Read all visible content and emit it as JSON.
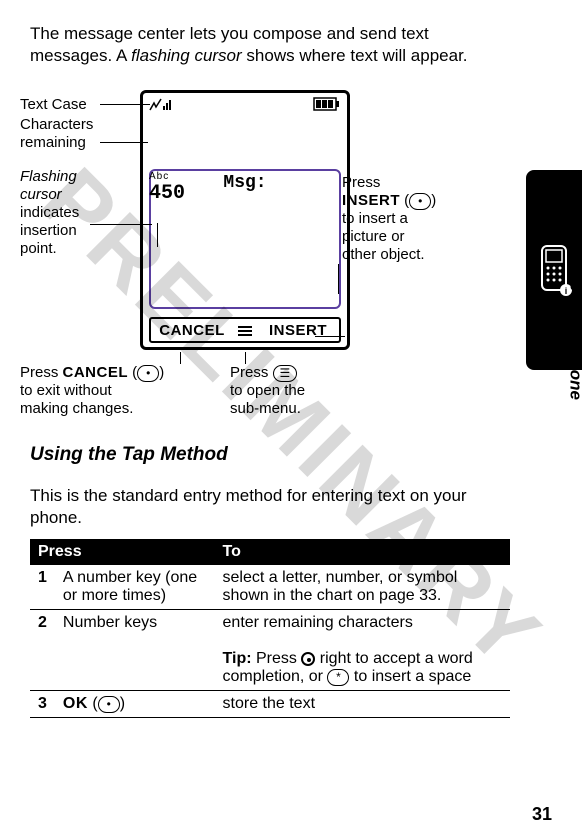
{
  "watermark": "PRELIMINARY",
  "intro_a": "The message center lets you compose and send text messages. A ",
  "intro_b_i": "flashing cursor",
  "intro_c": " shows where text will appear.",
  "screen": {
    "abc": "Abc",
    "count": "450",
    "msg": "Msg:",
    "cancel": "CANCEL",
    "insert": "INSERT"
  },
  "callouts": {
    "textcase": "Text Case",
    "chars1": "Characters",
    "chars2": "remaining",
    "flash1": "Flashing",
    "flash2": "cursor",
    "flash3": "indicates",
    "flash4": "insertion",
    "flash5": "point.",
    "right1": "Press",
    "right2": "INSERT",
    "right2b": " (",
    "right2c": ")",
    "right3": "to insert a",
    "right4": "picture or",
    "right5": "other object.",
    "bl1": "Press ",
    "bl2": "CANCEL",
    "bl3": " (",
    "bl4": ")",
    "bl5": "to exit without",
    "bl6": "making changes.",
    "bm1": "Press ",
    "bm2": "to open the",
    "bm3": "sub-menu."
  },
  "side_text": "Learning to Use Your Phone",
  "section_heading": "Using the Tap Method",
  "section_body": "This is the standard entry method for entering text on your phone.",
  "table": {
    "h1": "Press",
    "h2": "To",
    "r1n": "1",
    "r1a": "A number key (one or more times)",
    "r1b": "select a letter, number, or symbol shown in the chart on page 33.",
    "r2n": "2",
    "r2a": "Number keys",
    "r2b": "enter remaining characters",
    "r2tipA": "Tip:",
    "r2tipB": " Press ",
    "r2tipC": " right to accept a word completion, or ",
    "r2tipD": " to insert a space",
    "r3n": "3",
    "r3a": "OK",
    "r3b": " (",
    "r3c": ")",
    "r3action": "store the text"
  },
  "star": "*",
  "page_number": "31"
}
